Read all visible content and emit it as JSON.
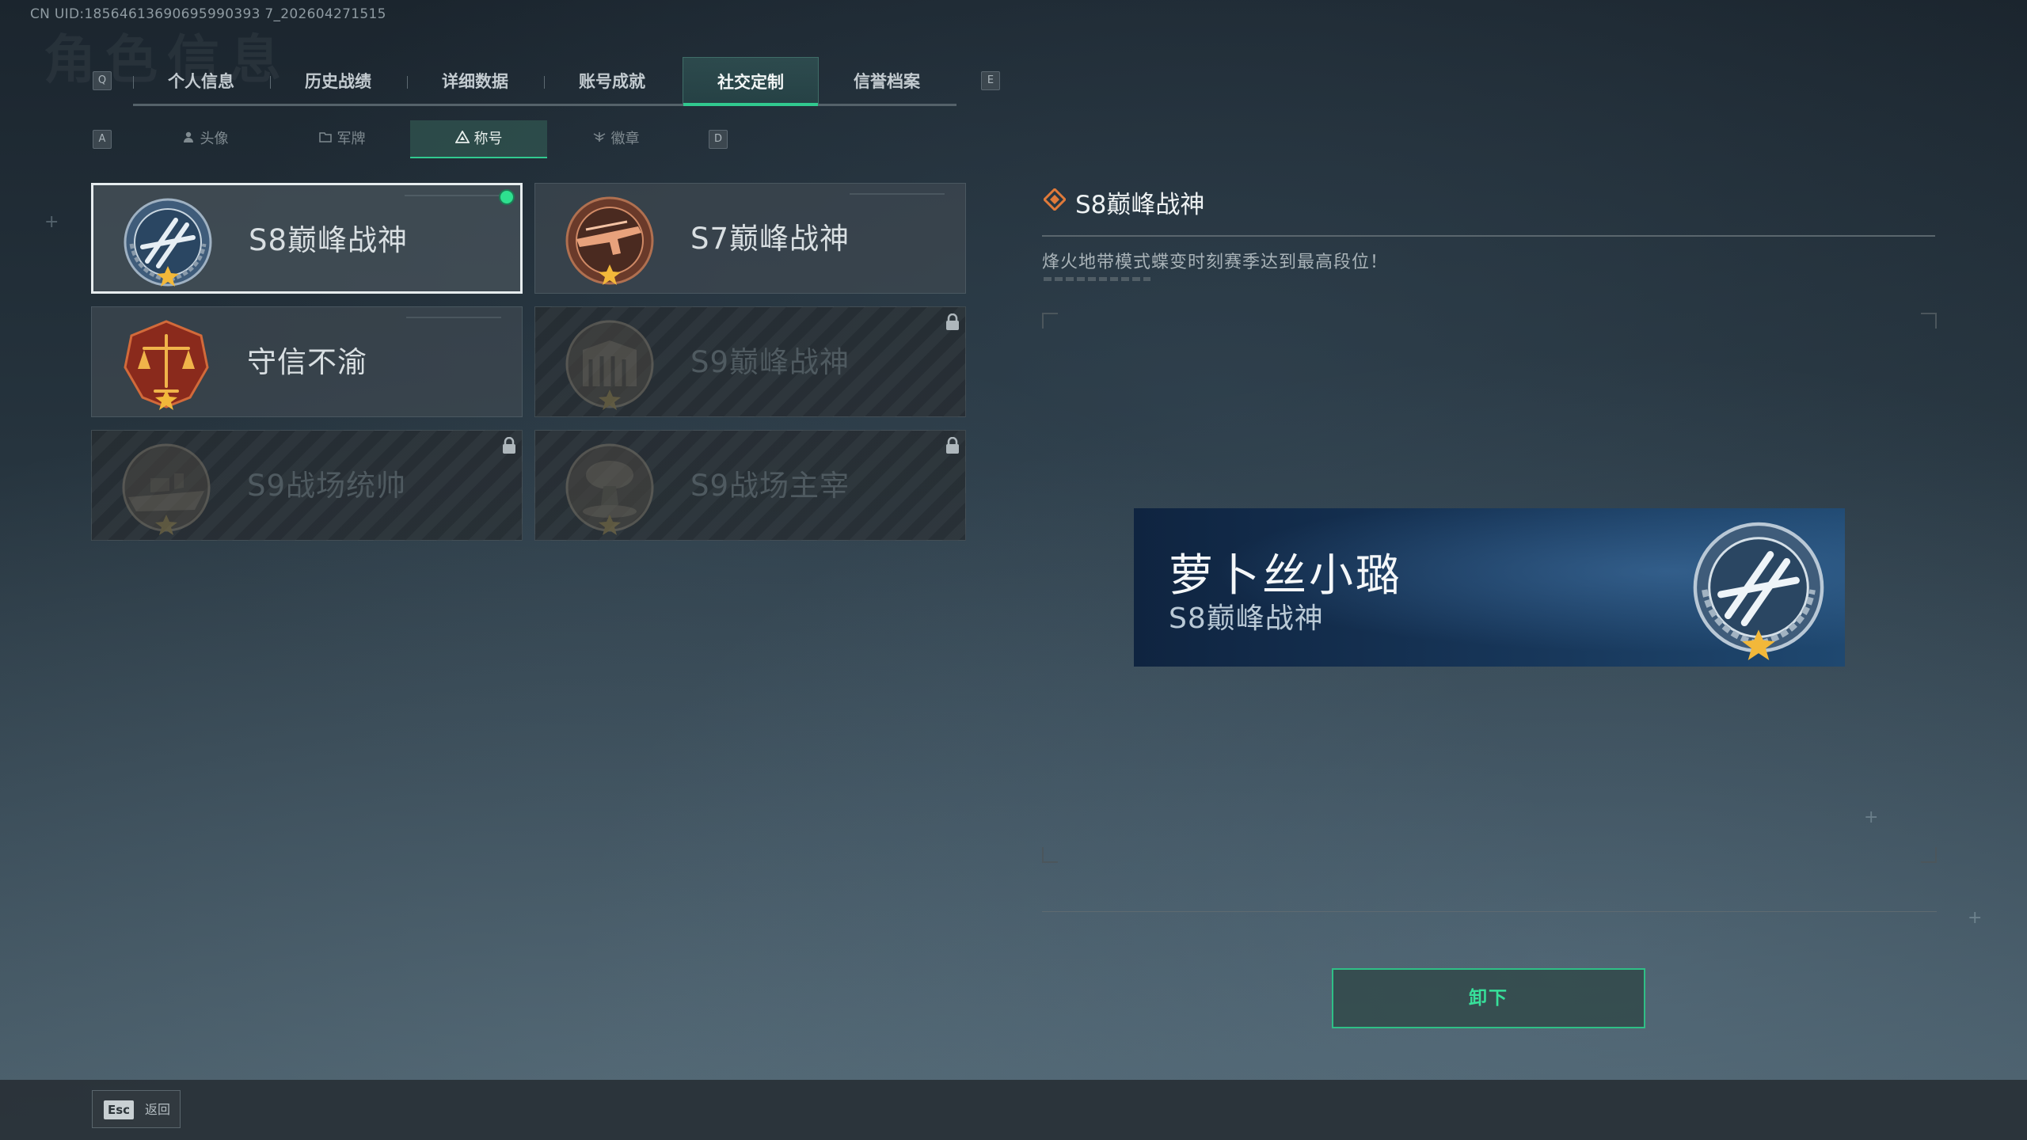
{
  "uid": "CN UID:18564613690695990393 7_202604271515",
  "key_hints": {
    "prev_tab": "Q",
    "next_tab": "E",
    "prev_sub": "A",
    "next_sub": "D"
  },
  "tabs": [
    {
      "label": "个人信息"
    },
    {
      "label": "历史战绩"
    },
    {
      "label": "详细数据"
    },
    {
      "label": "账号成就"
    },
    {
      "label": "社交定制",
      "active": true
    },
    {
      "label": "信誉档案"
    }
  ],
  "subtabs": [
    {
      "label": "头像"
    },
    {
      "label": "军牌"
    },
    {
      "label": "称号",
      "active": true
    },
    {
      "label": "徽章"
    }
  ],
  "cards": [
    {
      "name": "S8巅峰战神",
      "selected": true,
      "equipped": true,
      "locked": false,
      "icon": "s8-laurel-emblem-icon"
    },
    {
      "name": "S7巅峰战神",
      "selected": false,
      "equipped": false,
      "locked": false,
      "icon": "s7-rifle-emblem-icon"
    },
    {
      "name": "守信不渝",
      "selected": false,
      "equipped": false,
      "locked": false,
      "icon": "scales-emblem-icon"
    },
    {
      "name": "S9巅峰战神",
      "selected": false,
      "equipped": false,
      "locked": true,
      "icon": "s9-fortress-emblem-icon"
    },
    {
      "name": "S9战场统帅",
      "selected": false,
      "equipped": false,
      "locked": true,
      "icon": "warship-emblem-icon"
    },
    {
      "name": "S9战场主宰",
      "selected": false,
      "equipped": false,
      "locked": true,
      "icon": "mushroom-cloud-emblem-icon"
    }
  ],
  "detail": {
    "title": "S8巅峰战神",
    "description": "烽火地带模式蝶变时刻赛季达到最高段位！"
  },
  "preview": {
    "player_name": "萝卜丝小璐",
    "title": "S8巅峰战神"
  },
  "actions": {
    "unequip": "卸下"
  },
  "footer": {
    "esc_key": "Esc",
    "back_label": "返回"
  },
  "colors": {
    "accent": "#31c98f",
    "equipped_dot": "#2ee08f",
    "banner": "#173659"
  }
}
